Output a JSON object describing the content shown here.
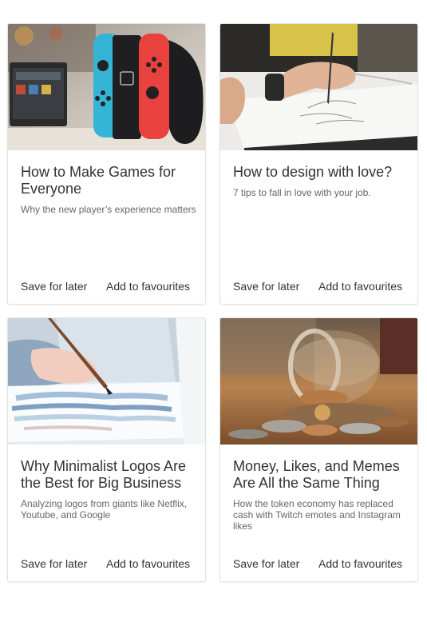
{
  "cards": [
    {
      "title": "How to Make Games for Everyone",
      "subtitle": "Why the new player’s experience matters",
      "image_icon": "game-controller-photo",
      "save_label": "Save for later",
      "fav_label": "Add to favourites"
    },
    {
      "title": "How to design with love?",
      "subtitle": "7 tips to fall in love with your job.",
      "image_icon": "drawing-hand-photo",
      "save_label": "Save for later",
      "fav_label": "Add to favourites"
    },
    {
      "title": "Why Minimalist Logos Are the Best for Big Business",
      "subtitle": "Analyzing logos from giants like Netflix, Youtube, and Google",
      "image_icon": "watercolor-painting-photo",
      "save_label": "Save for later",
      "fav_label": "Add to favourites"
    },
    {
      "title": "Money, Likes, and Memes Are All the Same Thing",
      "subtitle": "How the token economy has replaced cash with Twitch emotes and Instagram likes",
      "image_icon": "coin-jar-photo",
      "save_label": "Save for later",
      "fav_label": "Add to favourites"
    }
  ],
  "colors": {
    "title_text": "#333333",
    "subtitle_text": "#666666",
    "card_border": "#e3e3e3"
  }
}
